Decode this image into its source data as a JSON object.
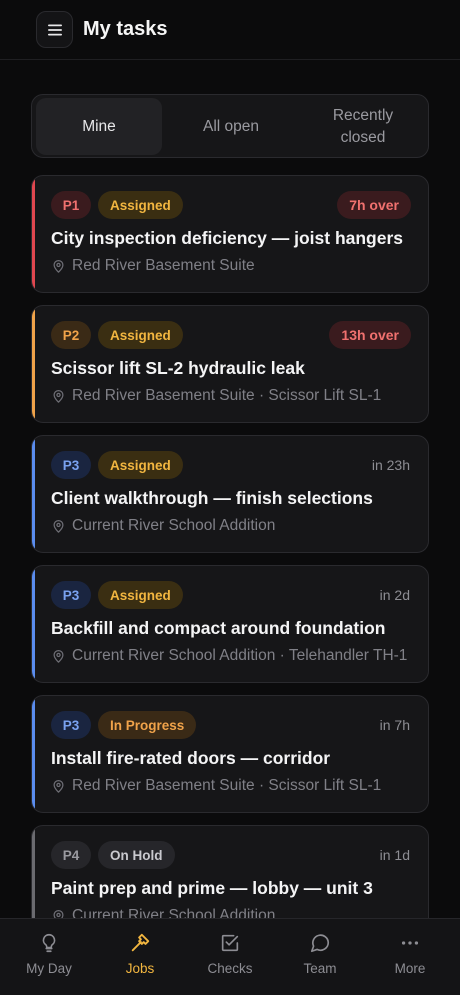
{
  "header": {
    "title": "My tasks",
    "menu_icon": "hamburger-menu-icon"
  },
  "tabs": [
    {
      "label": "Mine",
      "active": true
    },
    {
      "label": "All open",
      "active": false
    },
    {
      "label": "Recently closed",
      "active": false
    }
  ],
  "tasks": [
    {
      "priority": "P1",
      "status": "Assigned",
      "due": "7h over",
      "due_overdue": true,
      "title": "City inspection deficiency — joist hangers",
      "location": "Red River Basement Suite",
      "accent": "#e0474f"
    },
    {
      "priority": "P2",
      "status": "Assigned",
      "due": "13h over",
      "due_overdue": true,
      "title": "Scissor lift SL-2 hydraulic leak",
      "location": "Red River Basement Suite · Scissor Lift SL-1",
      "accent": "#f0a34a"
    },
    {
      "priority": "P3",
      "status": "Assigned",
      "due": "in 23h",
      "due_overdue": false,
      "title": "Client walkthrough — finish selections",
      "location": "Current River School Addition",
      "accent": "#5b8def"
    },
    {
      "priority": "P3",
      "status": "Assigned",
      "due": "in 2d",
      "due_overdue": false,
      "title": "Backfill and compact around foundation",
      "location": "Current River School Addition · Telehandler TH-1",
      "accent": "#5b8def"
    },
    {
      "priority": "P3",
      "status": "In Progress",
      "due": "in 7h",
      "due_overdue": false,
      "title": "Install fire-rated doors — corridor",
      "location": "Red River Basement Suite · Scissor Lift SL-1",
      "accent": "#5b8def"
    },
    {
      "priority": "P4",
      "status": "On Hold",
      "due": "in 1d",
      "due_overdue": false,
      "title": "Paint prep and prime — lobby — unit 3",
      "location": "Current River School Addition",
      "accent": "#6b6b70"
    }
  ],
  "nav": [
    {
      "label": "My Day",
      "icon": "lightbulb-icon",
      "active": false
    },
    {
      "label": "Jobs",
      "icon": "hammer-icon",
      "active": true
    },
    {
      "label": "Checks",
      "icon": "checkbox-icon",
      "active": false
    },
    {
      "label": "Team",
      "icon": "chat-bubble-icon",
      "active": false
    },
    {
      "label": "More",
      "icon": "more-dots-icon",
      "active": false
    }
  ]
}
